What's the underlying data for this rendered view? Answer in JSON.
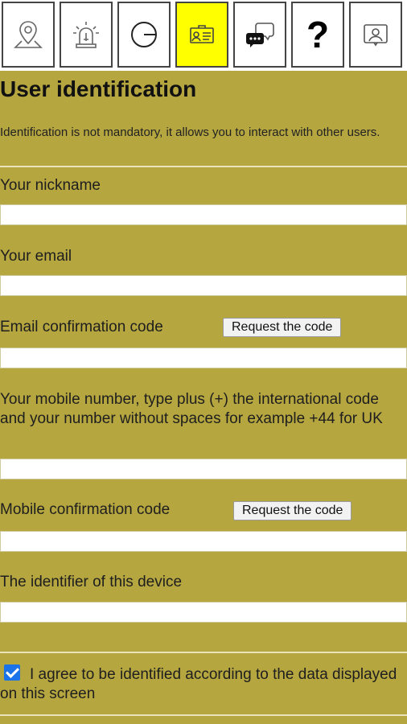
{
  "toolbar": {
    "items": [
      {
        "icon": "map-pin-icon"
      },
      {
        "icon": "alarm-siren-icon"
      },
      {
        "icon": "circle-line-icon"
      },
      {
        "icon": "id-card-icon",
        "active": true
      },
      {
        "icon": "chat-bubbles-icon"
      },
      {
        "icon": "question-icon",
        "symbol": "?"
      },
      {
        "icon": "profile-card-icon"
      }
    ],
    "active_color": "#ffff00"
  },
  "page": {
    "title": "User identification",
    "intro": "Identification is not mandatory, it allows you to interact with other users."
  },
  "form": {
    "nickname": {
      "label": "Your nickname",
      "value": ""
    },
    "email": {
      "label": "Your email",
      "value": ""
    },
    "email_code": {
      "label": "Email confirmation code",
      "value": "",
      "button": "Request the code"
    },
    "mobile": {
      "label": "Your mobile number, type plus (+) the international code and your number without spaces for example +44 for UK",
      "value": ""
    },
    "mobile_code": {
      "label": "Mobile confirmation code",
      "value": "",
      "button": "Request the code"
    },
    "device": {
      "label": "The identifier of this device",
      "value": ""
    },
    "agree": {
      "label": "I agree to be identified according to the data displayed on this screen",
      "checked": true
    }
  },
  "colors": {
    "background": "#b5a640",
    "checkbox": "#1a73e8"
  }
}
